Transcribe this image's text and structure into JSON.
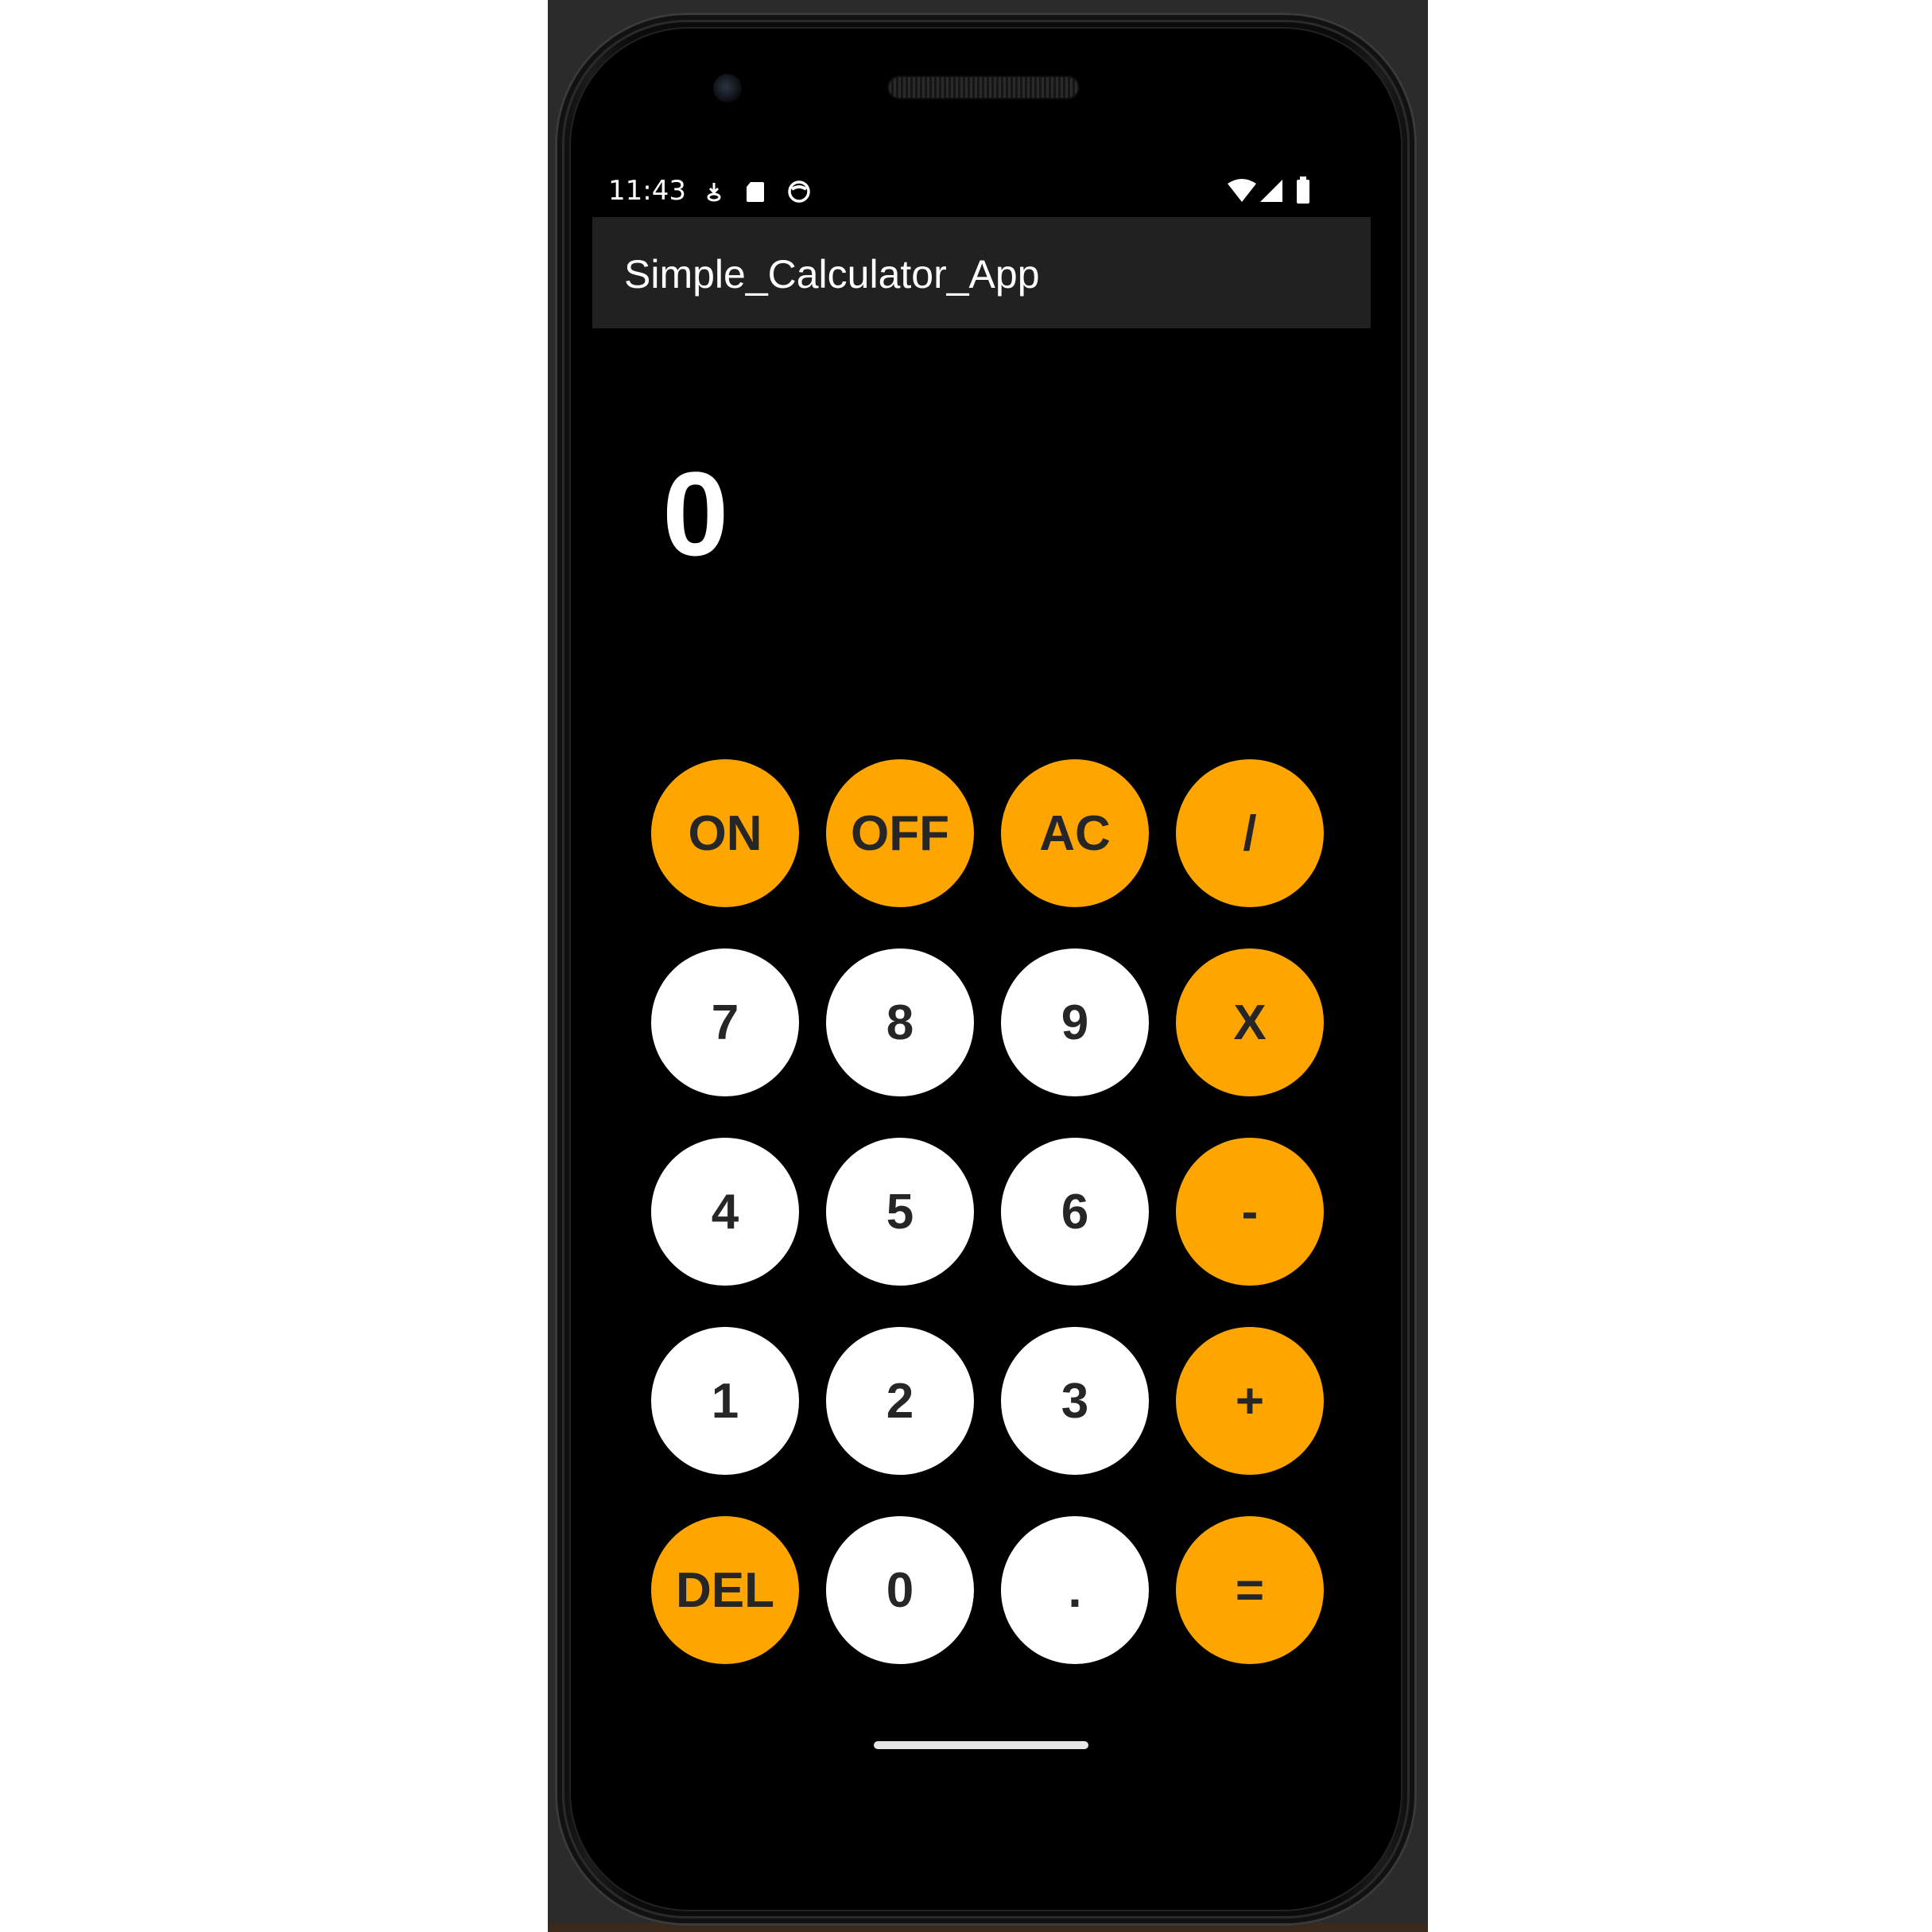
{
  "status_bar": {
    "time": "11:43",
    "left_icons": [
      "download-icon",
      "sd-card-icon",
      "smiley-icon"
    ],
    "right_icons": [
      "wifi-icon",
      "signal-icon",
      "battery-icon"
    ]
  },
  "app_bar": {
    "title": "Simple_Calculator_App"
  },
  "display": {
    "value": "0"
  },
  "keypad": {
    "keys": [
      {
        "label": "ON",
        "style": "orange"
      },
      {
        "label": "OFF",
        "style": "orange"
      },
      {
        "label": "AC",
        "style": "orange"
      },
      {
        "label": "/",
        "style": "orange"
      },
      {
        "label": "7",
        "style": "white"
      },
      {
        "label": "8",
        "style": "white"
      },
      {
        "label": "9",
        "style": "white"
      },
      {
        "label": "X",
        "style": "orange"
      },
      {
        "label": "4",
        "style": "white"
      },
      {
        "label": "5",
        "style": "white"
      },
      {
        "label": "6",
        "style": "white"
      },
      {
        "label": "-",
        "style": "orange"
      },
      {
        "label": "1",
        "style": "white"
      },
      {
        "label": "2",
        "style": "white"
      },
      {
        "label": "3",
        "style": "white"
      },
      {
        "label": "+",
        "style": "orange"
      },
      {
        "label": "DEL",
        "style": "orange"
      },
      {
        "label": "0",
        "style": "white"
      },
      {
        "label": ".",
        "style": "white"
      },
      {
        "label": "=",
        "style": "orange"
      }
    ]
  },
  "colors": {
    "accent": "#FFA500",
    "digit_key": "#FFFFFF",
    "app_bar": "#212121",
    "background": "#000000",
    "key_text": "#262626"
  }
}
